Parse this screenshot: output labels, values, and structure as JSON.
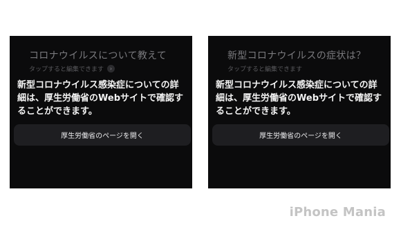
{
  "panels": [
    {
      "query": "コロナウイルスについて教えて",
      "edit_hint": "タップすると編集できます",
      "answer_lines": [
        "新型コロナウイルス感染症についての詳",
        "細は、厚生労働省のWebサイトで確認す",
        "ることができます。"
      ],
      "button_label": "厚生労働省のページを開く"
    },
    {
      "query": "新型コロナウイルスの症状は？",
      "edit_hint": "タップすると編集できます",
      "answer_lines": [
        "新型コロナウイルス感染症についての詳",
        "細は、厚生労働省のWebサイトで確認す",
        "ることができます。"
      ],
      "button_label": "厚生労働省のページを開く"
    }
  ],
  "brand": "iPhone Mania",
  "icons": {
    "edit_chevron": "chevron-right-icon"
  },
  "colors": {
    "panel_background": "#0b0b0c",
    "button_background": "#1e1e21",
    "query_text": "#7a7a7e",
    "answer_text": "#f4f4f4"
  }
}
